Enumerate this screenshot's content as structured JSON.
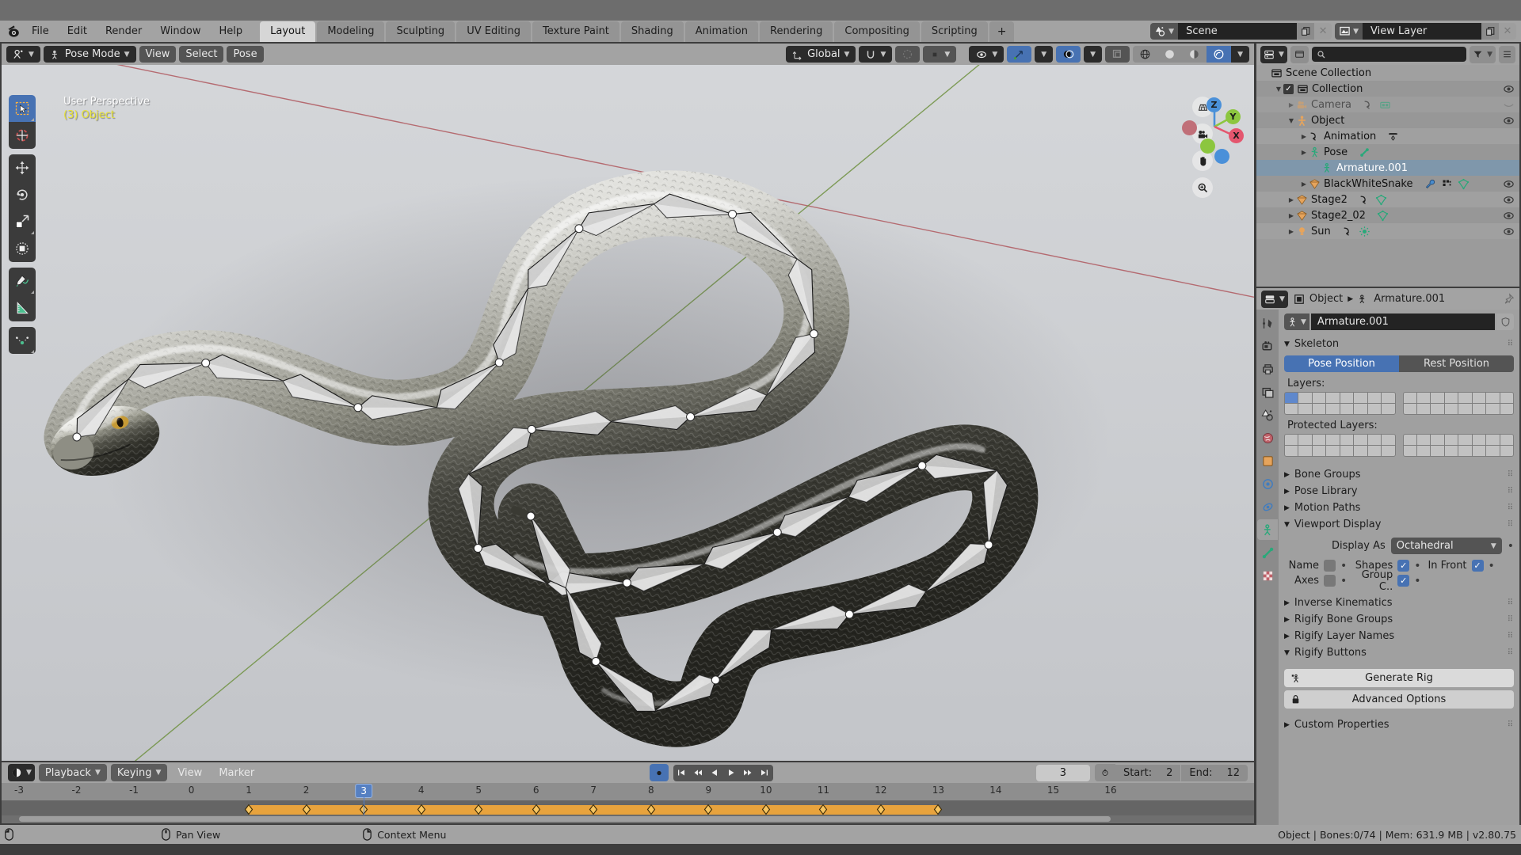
{
  "app": {
    "version_status": "Object | Bones:0/74  | Mem: 631.9 MB | v2.80.75"
  },
  "menubar": {
    "logo_icon": "blender-logo-icon",
    "items": [
      "File",
      "Edit",
      "Render",
      "Window",
      "Help"
    ],
    "workspace_tabs": [
      {
        "label": "Layout",
        "selected": true
      },
      {
        "label": "Modeling",
        "selected": false
      },
      {
        "label": "Sculpting",
        "selected": false
      },
      {
        "label": "UV Editing",
        "selected": false
      },
      {
        "label": "Texture Paint",
        "selected": false
      },
      {
        "label": "Shading",
        "selected": false
      },
      {
        "label": "Animation",
        "selected": false
      },
      {
        "label": "Rendering",
        "selected": false
      },
      {
        "label": "Compositing",
        "selected": false
      },
      {
        "label": "Scripting",
        "selected": false
      }
    ],
    "add_workspace_label": "+",
    "scene_field": {
      "icon": "scene-icon",
      "value": "Scene",
      "copy_icon": "duplicate-icon",
      "unlink_icon": "x-icon"
    },
    "view_layer_field": {
      "icon": "view-layer-icon",
      "value": "View Layer",
      "copy_icon": "duplicate-icon",
      "unlink_icon": "x-icon"
    }
  },
  "viewport": {
    "header": {
      "editor_type_icon": "editor-type-3dview-icon",
      "mode": "Pose Mode",
      "menus": [
        "View",
        "Select",
        "Pose"
      ],
      "transform_orientation": "Global",
      "snap_icon": "magnet-icon",
      "proportional_icon": "proportional-edit-icon",
      "pivot_icon": "pivot-icon",
      "overlay_visibility_icon": "visibility-icon",
      "gizmo_icon": "gizmo-icon",
      "overlays_icon": "overlays-icon",
      "xray_icon": "xray-icon",
      "shading_modes": [
        "wireframe",
        "solid",
        "material-preview",
        "rendered"
      ],
      "shading_selected": "rendered"
    },
    "overlay_text": {
      "perspective": "User Perspective",
      "active_object": "(3) Object"
    },
    "toolbar": [
      {
        "name": "tweak-select-tool",
        "selected": true
      },
      {
        "name": "cursor-tool",
        "selected": false
      },
      {
        "name": "move-tool",
        "selected": false
      },
      {
        "name": "rotate-tool",
        "selected": false
      },
      {
        "name": "scale-tool",
        "selected": false
      },
      {
        "name": "transform-tool",
        "selected": false
      },
      {
        "name": "annotate-tool",
        "selected": false
      },
      {
        "name": "measure-tool",
        "selected": false
      },
      {
        "name": "breakdowner-tool",
        "selected": false
      }
    ],
    "nav_buttons": [
      "grid-view-icon",
      "camera-view-icon",
      "pan-hand-icon",
      "zoom-magnifier-icon"
    ],
    "gizmo_axes": [
      {
        "label": "Z",
        "color": "#4a90d9"
      },
      {
        "label": "Y",
        "color": "#8cc63f"
      },
      {
        "label": "X",
        "color": "#e4566e"
      }
    ]
  },
  "outliner": {
    "display_mode_icon": "outliner-display-mode-icon",
    "filter_icon": "filter-icon",
    "search_placeholder": "",
    "search_icon": "search-icon",
    "new_collection_icon": "new-collection-icon",
    "rows": [
      {
        "label": "Scene Collection",
        "indent": 0,
        "icon": "scene-collection-icon",
        "disclosure": "",
        "checkbox": false,
        "eye": false,
        "dim": false,
        "selected": false,
        "extras": []
      },
      {
        "label": "Collection",
        "indent": 1,
        "icon": "collection-icon",
        "disclosure": "down",
        "checkbox": true,
        "eye": true,
        "dim": false,
        "selected": false,
        "extras": []
      },
      {
        "label": "Camera",
        "indent": 2,
        "icon": "camera-object-icon",
        "disclosure": "right",
        "checkbox": false,
        "eye": "hidden",
        "dim": true,
        "selected": false,
        "extras": [
          "anim-arrow-icon",
          "camera-data-icon"
        ]
      },
      {
        "label": "Object",
        "indent": 2,
        "icon": "armature-object-icon",
        "disclosure": "down",
        "checkbox": false,
        "eye": true,
        "dim": false,
        "selected": false,
        "extras": []
      },
      {
        "label": "Animation",
        "indent": 3,
        "icon": "anim-arrow-icon",
        "disclosure": "right",
        "checkbox": false,
        "eye": false,
        "dim": false,
        "selected": false,
        "extras": [
          "action-icon"
        ]
      },
      {
        "label": "Pose",
        "indent": 3,
        "icon": "pose-icon",
        "disclosure": "right",
        "checkbox": false,
        "eye": false,
        "dim": false,
        "selected": false,
        "extras": [
          "bone-icon"
        ]
      },
      {
        "label": "Armature.001",
        "indent": 4,
        "icon": "armature-data-icon",
        "disclosure": "",
        "checkbox": false,
        "eye": false,
        "dim": false,
        "selected": true,
        "extras": []
      },
      {
        "label": "BlackWhiteSnake",
        "indent": 3,
        "icon": "mesh-object-icon",
        "disclosure": "right",
        "checkbox": false,
        "eye": true,
        "dim": false,
        "selected": false,
        "extras": [
          "modifier-wrench-icon",
          "vertex-group-icon",
          "mesh-data-icon"
        ]
      },
      {
        "label": "Stage2",
        "indent": 2,
        "icon": "mesh-object-icon",
        "disclosure": "right",
        "checkbox": false,
        "eye": true,
        "dim": false,
        "selected": false,
        "extras": [
          "anim-arrow-icon",
          "mesh-data-icon"
        ]
      },
      {
        "label": "Stage2_02",
        "indent": 2,
        "icon": "mesh-object-icon",
        "disclosure": "right",
        "checkbox": false,
        "eye": true,
        "dim": false,
        "selected": false,
        "extras": [
          "mesh-data-icon"
        ]
      },
      {
        "label": "Sun",
        "indent": 2,
        "icon": "light-object-icon",
        "disclosure": "right",
        "checkbox": false,
        "eye": true,
        "dim": false,
        "selected": false,
        "extras": [
          "anim-arrow-icon",
          "light-data-icon"
        ]
      }
    ]
  },
  "properties": {
    "editor_icon": "properties-editor-icon",
    "breadcrumb": [
      "Object",
      "Armature.001"
    ],
    "pin_icon": "pin-icon",
    "datablock_name": "Armature.001",
    "datablock_icon": "armature-data-icon",
    "shield_icon": "fake-user-shield-icon",
    "tabs": [
      {
        "name": "tool-tab",
        "icon": "tool-icon",
        "selected": false
      },
      {
        "name": "render-tab",
        "icon": "render-camera-icon",
        "selected": false
      },
      {
        "name": "output-tab",
        "icon": "printer-icon",
        "selected": false
      },
      {
        "name": "view-layer-tab",
        "icon": "images-icon",
        "selected": false
      },
      {
        "name": "scene-tab",
        "icon": "scene-cone-icon",
        "selected": false
      },
      {
        "name": "world-tab",
        "icon": "world-globe-icon",
        "selected": false
      },
      {
        "name": "object-tab",
        "icon": "object-square-icon",
        "selected": false
      },
      {
        "name": "modifiers-tab",
        "icon": "physics-blue-icon",
        "selected": false
      },
      {
        "name": "particles-tab",
        "icon": "particles-icon",
        "selected": false
      },
      {
        "name": "object-data-tab",
        "icon": "armature-green-icon",
        "selected": true
      },
      {
        "name": "bone-tab",
        "icon": "bone-green-icon",
        "selected": false
      },
      {
        "name": "texture-tab",
        "icon": "texture-checker-icon",
        "selected": false
      }
    ],
    "skeleton": {
      "title": "Skeleton",
      "pose_position": "Pose Position",
      "rest_position": "Rest Position",
      "pose_selected": true,
      "layers_label": "Layers:",
      "protected_layers_label": "Protected Layers:",
      "active_layer_index": 0
    },
    "panels": [
      {
        "label": "Bone Groups",
        "open": false
      },
      {
        "label": "Pose Library",
        "open": false
      },
      {
        "label": "Motion Paths",
        "open": false
      },
      {
        "label": "Viewport Display",
        "open": true
      }
    ],
    "viewport_display": {
      "display_as_label": "Display As",
      "display_as_value": "Octahedral",
      "name_label": "Name",
      "name_checked": false,
      "shapes_label": "Shapes",
      "shapes_checked": true,
      "in_front_label": "In Front",
      "in_front_checked": true,
      "axes_label": "Axes",
      "axes_checked": false,
      "group_colors_label": "Group C..",
      "group_colors_checked": true
    },
    "panels_lower": [
      {
        "label": "Inverse Kinematics",
        "open": false
      },
      {
        "label": "Rigify Bone Groups",
        "open": false
      },
      {
        "label": "Rigify Layer Names",
        "open": false
      },
      {
        "label": "Rigify Buttons",
        "open": true
      }
    ],
    "rigify": {
      "generate_rig": "Generate Rig",
      "generate_icon": "armature-small-icon",
      "advanced_options": "Advanced Options",
      "advanced_icon": "lock-icon"
    },
    "custom_properties": {
      "label": "Custom Properties",
      "open": false
    }
  },
  "timeline": {
    "editor_icon": "timeline-editor-icon",
    "menus": [
      "Playback",
      "Keying",
      "View",
      "Marker"
    ],
    "record_icon": "record-icon",
    "transport": [
      "jump-start-icon",
      "prev-keyframe-icon",
      "play-reverse-icon",
      "play-icon",
      "next-keyframe-icon",
      "jump-end-icon"
    ],
    "current_frame": "3",
    "auto_key_icon": "stopwatch-icon",
    "start_label": "Start:",
    "start_value": "2",
    "end_label": "End:",
    "end_value": "12",
    "ruler_ticks": [
      "-3",
      "-2",
      "-1",
      "0",
      "1",
      "2",
      "3",
      "4",
      "5",
      "6",
      "7",
      "8",
      "9",
      "10",
      "11",
      "12",
      "13",
      "14",
      "15",
      "16"
    ],
    "keyframes": [
      1,
      2,
      3,
      4,
      5,
      6,
      7,
      8,
      9,
      10,
      11,
      12,
      13
    ],
    "keyframe_range": [
      1,
      13
    ]
  },
  "statusbar": {
    "hints": [
      {
        "icon": "mouse-left-icon",
        "label": ""
      },
      {
        "icon": "mouse-middle-icon",
        "label": "Pan View"
      },
      {
        "icon": "mouse-right-icon",
        "label": "Context Menu"
      }
    ],
    "status": "Object | Bones:0/74  | Mem: 631.9 MB | v2.80.75"
  },
  "colors": {
    "accent_blue": "#4772b3",
    "keyframe_orange": "#e8a33d",
    "axis_x": "#e4566e",
    "axis_y": "#8cc63f",
    "axis_z": "#4a90d9",
    "selected_row": "#7f97ab"
  }
}
